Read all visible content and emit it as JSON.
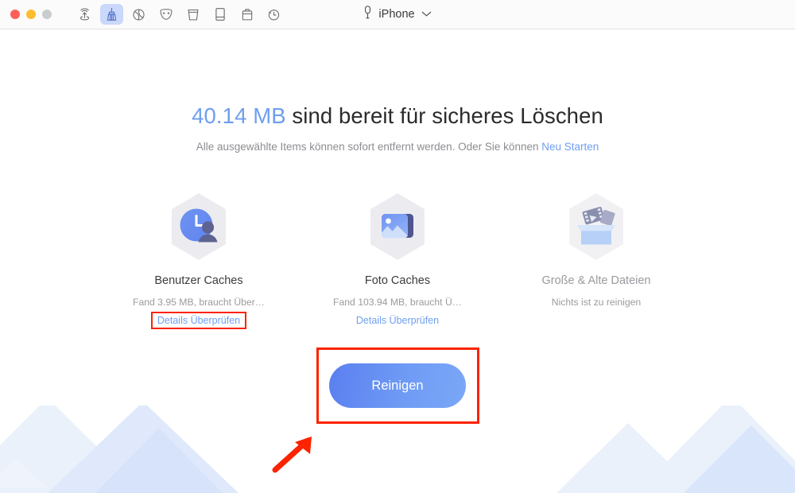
{
  "window": {
    "traffic_lights": [
      {
        "name": "close",
        "color": "#ff5f57"
      },
      {
        "name": "minimize",
        "color": "#febc2e"
      },
      {
        "name": "zoom",
        "color": "#c9ccce"
      }
    ],
    "toolbar_icons": [
      {
        "name": "airdrop-icon",
        "label": "AirDrop",
        "active": false
      },
      {
        "name": "broom-icon",
        "label": "Clean",
        "active": true
      },
      {
        "name": "globe-icon",
        "label": "Globe",
        "active": false
      },
      {
        "name": "mask-icon",
        "label": "Privacy",
        "active": false
      },
      {
        "name": "trash-icon",
        "label": "Eraser",
        "active": false
      },
      {
        "name": "device-icon",
        "label": "Device",
        "active": false
      },
      {
        "name": "toolbox-icon",
        "label": "Toolkit",
        "active": false
      },
      {
        "name": "clock-icon",
        "label": "History",
        "active": false
      }
    ],
    "device": {
      "icon": "device-icon",
      "name": "iPhone",
      "chevron": "chevron-down-icon"
    }
  },
  "main": {
    "headline": {
      "amount": "40.14 MB",
      "rest": " sind bereit für sicheres Löschen"
    },
    "subline": {
      "text": "Alle ausgewählte Items können sofort entfernt werden. Oder Sie können ",
      "link": "Neu Starten"
    },
    "cards": [
      {
        "icon": "user-caches-icon",
        "title": "Benutzer Caches",
        "subtitle": "Fand 3.95 MB, braucht Über…",
        "link": "Details Überprüfen",
        "has_link": true,
        "highlighted": true,
        "disabled": false
      },
      {
        "icon": "photo-caches-icon",
        "title": "Foto Caches",
        "subtitle": "Fand 103.94 MB, braucht Ü…",
        "link": "Details Überprüfen",
        "has_link": true,
        "highlighted": false,
        "disabled": false
      },
      {
        "icon": "large-old-files-icon",
        "title": "Große & Alte Dateien",
        "subtitle": "Nichts ist zu reinigen",
        "link": "",
        "has_link": false,
        "highlighted": false,
        "disabled": true
      }
    ],
    "cta": {
      "label": "Reinigen",
      "highlighted": true
    }
  },
  "annotations": {
    "highlight_color": "#fc2300",
    "arrow": {
      "name": "red-arrow-pointer",
      "direction": "up-right"
    }
  },
  "colors": {
    "accent_blue": "#6e9ef0",
    "text_dark": "#2b2b2b",
    "text_muted": "#9b9ba0",
    "mountain_light": "#eaf1fb",
    "mountain_mid": "#d6e3fa"
  }
}
